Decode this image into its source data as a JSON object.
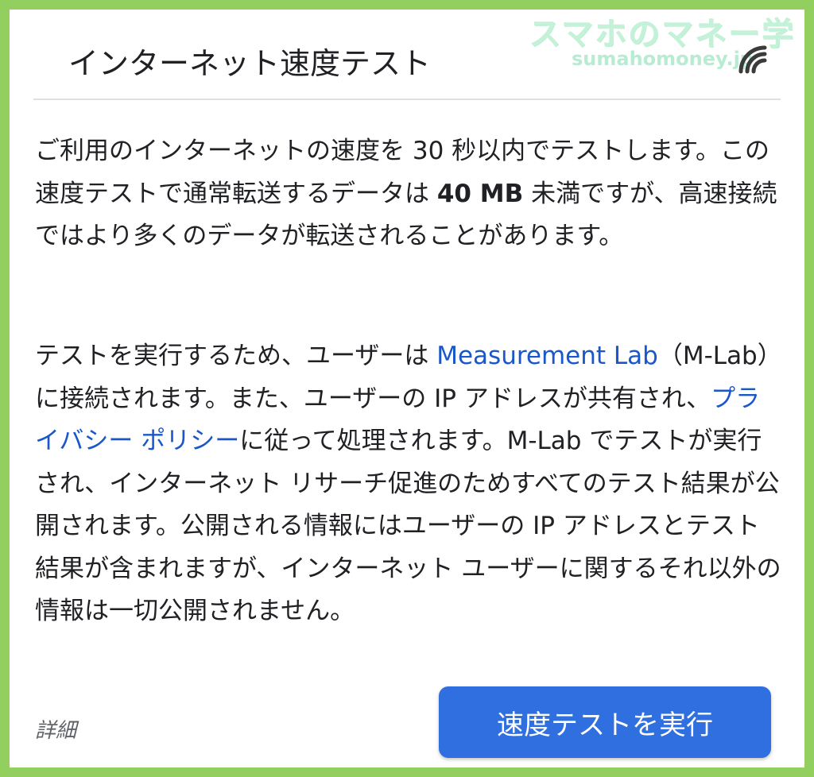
{
  "dialog": {
    "title": "インターネット速度テスト",
    "para1": {
      "text_a": "ご利用のインターネットの速度を 30 秒以内でテストします。この速度テストで通常転送するデータは ",
      "text_bold": "40 MB",
      "text_b": " 未満ですが、高速接続ではより多くのデータが転送されることがあります。"
    },
    "para2": {
      "text_a": "テストを実行するため、ユーザーは ",
      "link_mlab": "Measurement Lab",
      "text_b": "（M-Lab）に接続されます。また、ユーザーの IP アドレスが共有され、",
      "link_privacy": "プライバシー ポリシー",
      "text_c": "に従って処理されます。M-Lab でテストが実行され、インターネット リサーチ促進のためすべてのテスト結果が公開されます。公開される情報にはユーザーの IP アドレスとテスト結果が含まれますが、インターネット ユーザーに関するそれ以外の情報は一切公開されません。"
    },
    "details_label": "詳細",
    "run_button_label": "速度テストを実行"
  },
  "watermark": {
    "title": "スマホのマネー学",
    "url": "sumahomoney.jp"
  },
  "colors": {
    "frame": "#93cf5e",
    "link": "#1a57c9",
    "button": "#2f6fe0",
    "text": "#202124"
  }
}
